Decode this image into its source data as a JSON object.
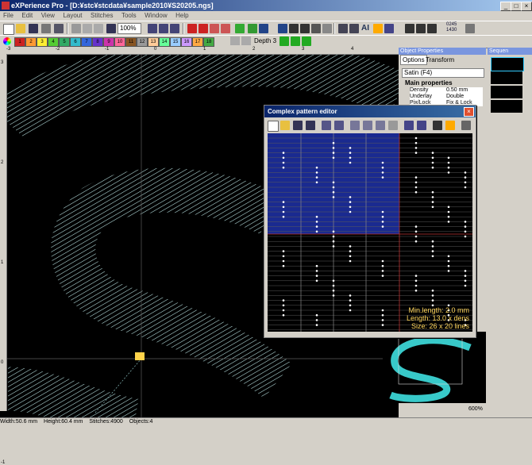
{
  "title": "eXPerience Pro - [D:¥stc¥stcdata¥sample2010¥S20205.ngs]",
  "window_controls": [
    "_",
    "□",
    "×"
  ],
  "menu": [
    "File",
    "Edit",
    "View",
    "Layout",
    "Stitches",
    "Tools",
    "Window",
    "Help"
  ],
  "toolbar": {
    "zoom": "100%",
    "depth": "Depth 3",
    "counter_top": "0245",
    "counter_bottom": "1430"
  },
  "palette": {
    "colors": [
      "#cc2222",
      "#ff9933",
      "#ffee33",
      "#55cc33",
      "#33aa66",
      "#33bbcc",
      "#3366dd",
      "#6633cc",
      "#cc33aa",
      "#ff6699",
      "#885522",
      "#999999",
      "#ffcc99",
      "#66ff99",
      "#99ccff",
      "#cc99ff",
      "#ffaa44",
      "#44aa44"
    ],
    "numbers": [
      "1",
      "2",
      "3",
      "4",
      "5",
      "6",
      "7",
      "8",
      "9",
      "10",
      "11",
      "12",
      "13",
      "14",
      "15",
      "16",
      "17",
      "18"
    ]
  },
  "ruler": {
    "h_ticks": [
      "-3",
      "-2",
      "-1",
      "0",
      "1",
      "2",
      "3",
      "4"
    ],
    "v_ticks": [
      "3",
      "2",
      "1",
      "0",
      "-1"
    ]
  },
  "object_properties": {
    "header": "Object Properties",
    "tabs": [
      "Options",
      "Transform"
    ],
    "stitch_type": "Satin (F4)",
    "section": "Main properties",
    "rows": [
      {
        "name": "Density",
        "value": "0.50 mm"
      },
      {
        "name": "Underlay",
        "value": "Double"
      },
      {
        "name": "Pix/Lock",
        "value": "Fix & Lock"
      }
    ],
    "zoom": "600%"
  },
  "sequence": {
    "header": "Sequen"
  },
  "status": {
    "width": "Width:50.6 mm",
    "height": "Height:60.4 mm",
    "stitches": "Stitches:4900",
    "objects": "Objects:4"
  },
  "dialog": {
    "title": "Complex pattern editor",
    "close": "×",
    "min_length": "Min.length: 2.0 mm",
    "length": "Length: 13.0 x dens",
    "size": "Size: 26 x 20 lines"
  },
  "colors": {
    "titlebar": "#0a246a",
    "satin": "#bfeaea",
    "thread_preview": "#38c9c9",
    "highlight_blue": "#1a2a90",
    "info_text": "#ffd65c"
  }
}
